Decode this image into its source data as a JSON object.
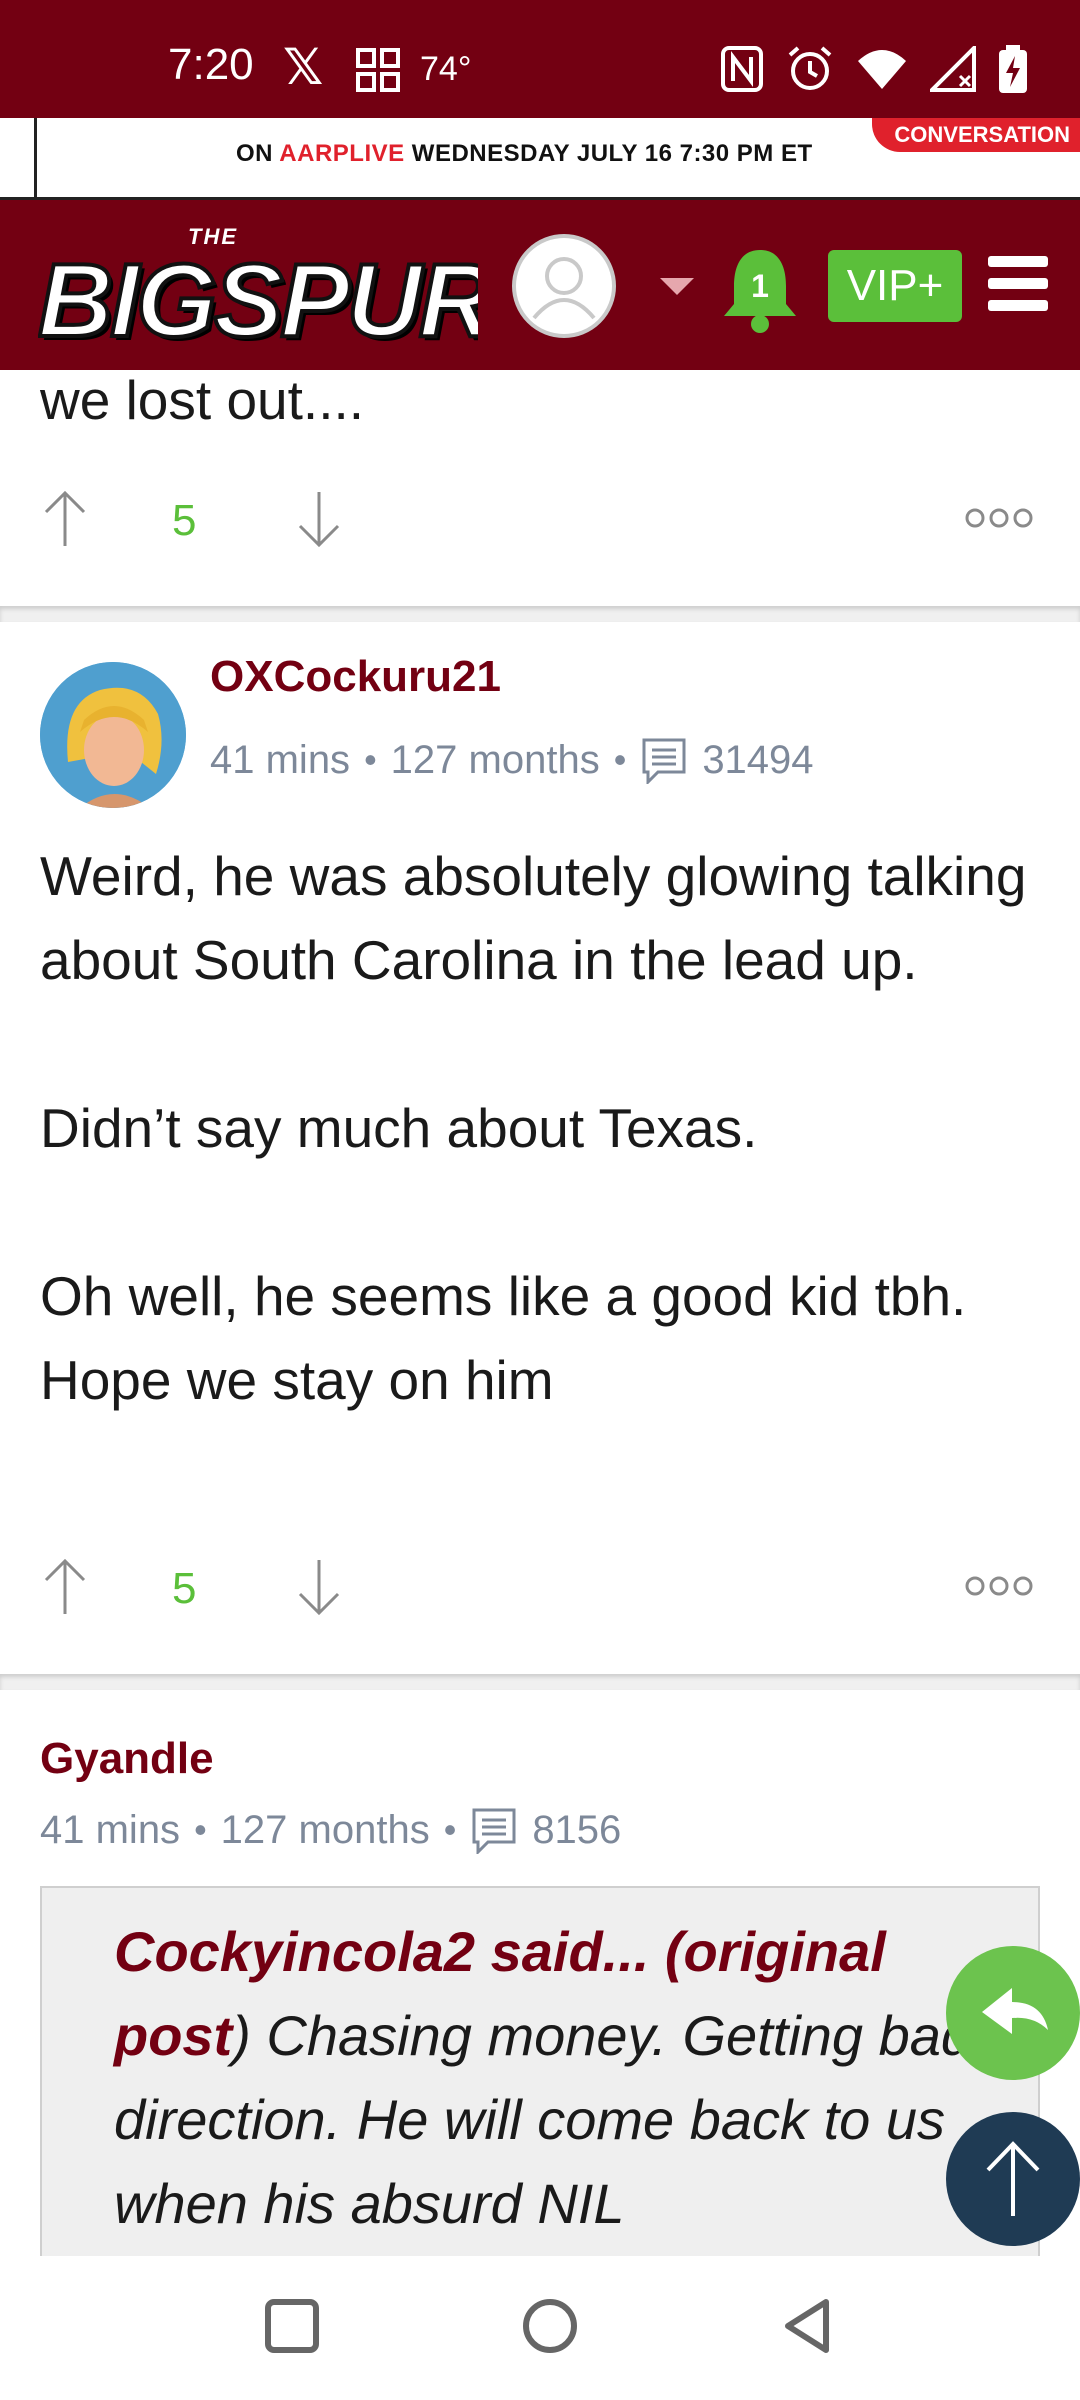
{
  "status_bar": {
    "time": "7:20",
    "temperature": "74°",
    "icons": [
      "x-icon",
      "grid-app-icon",
      "nfc-icon",
      "alarm-icon",
      "wifi-icon",
      "signal-icon",
      "battery-charging-icon"
    ]
  },
  "ad_banner": {
    "prefix": "ON ",
    "brand": "AARPLIVE",
    "text": " WEDNESDAY JULY 16 7:30 PM ET",
    "badge": "CONVERSATION"
  },
  "header": {
    "logo_small": "THE",
    "logo_main": "BIGSPUR",
    "notification_count": "1",
    "vip_label": "VIP+"
  },
  "previous_comment": {
    "text_tail": "we lost out....",
    "votes": "5"
  },
  "comments": [
    {
      "username": "OXCockuru21",
      "time": "41 mins",
      "tenure": "127 months",
      "post_count": "31494",
      "paragraphs": [
        "Weird, he was absolutely glowing talking about South Carolina in the lead up.",
        "Didn’t say much about Texas.",
        "Oh well, he seems like a good kid tbh. Hope we stay on him"
      ],
      "votes": "5"
    },
    {
      "username": "Gyandle",
      "time": "41 mins",
      "tenure": "127 months",
      "post_count": "8156",
      "quote": {
        "author": "Cockyincola2 said...",
        "link_open": " (original",
        "link_close": "post",
        "paren": ")",
        "text": " Chasing money. Getting bad direction. He will come back to us when his absurd NIL"
      }
    }
  ],
  "colors": {
    "brand": "#730012",
    "accent_green": "#5bbf3a",
    "meta_gray": "#7d8899",
    "fab_dark": "#1f3b54"
  }
}
